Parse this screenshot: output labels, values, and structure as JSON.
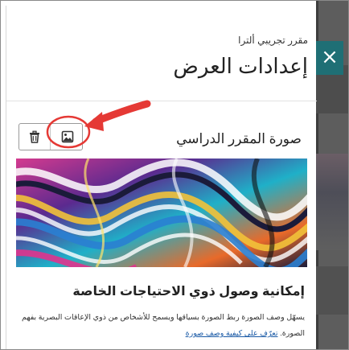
{
  "panel": {
    "course_name": "مقرر تجريبي ألترا",
    "title": "إعدادات العرض",
    "close_label": "×"
  },
  "course_image": {
    "section_title": "صورة المقرر الدراسي",
    "banner_alt": "marbled colorful abstract image"
  },
  "accessibility": {
    "title": "إمكانية وصول ذوي الاحتياجات الخاصة",
    "description": "يسهّل وصف الصورة ربط الصورة بسياقها ويسمح للأشخاص من ذوي الإعاقات البصرية بفهم الصورة.",
    "link_label": "تعرّف على كيفية وصف صورة"
  },
  "icons": {
    "close": "close-icon",
    "trash": "trash-icon",
    "image": "image-icon"
  },
  "colors": {
    "close_button": "#1f6f75",
    "annotation": "#e53935",
    "link": "#1a5aa6"
  }
}
